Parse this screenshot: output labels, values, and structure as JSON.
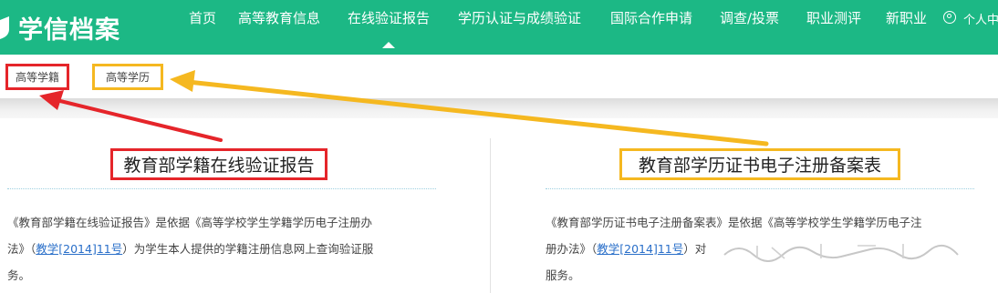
{
  "brand": {
    "name": "学信档案"
  },
  "nav": {
    "items": [
      "首页",
      "高等教育信息",
      "在线验证报告",
      "学历认证与成绩验证",
      "国际合作申请",
      "调查/投票",
      "职业测评",
      "新职业"
    ],
    "active": "在线验证报告",
    "user_label": "个人中"
  },
  "tabs": {
    "left": "高等学籍",
    "right": "高等学历"
  },
  "panels": {
    "left": {
      "title": "教育部学籍在线验证报告",
      "desc_line1": "《教育部学籍在线验证报告》是依据《高等学校学生学籍学历电子注册办",
      "desc_line2_pre": "法》（",
      "desc_link": "教学[2014]11号",
      "desc_line2_post": "）为学生本人提供的学籍注册信息网上查询验证服",
      "desc_line3": "务。"
    },
    "right": {
      "title": "教育部学历证书电子注册备案表",
      "desc_line1": "《教育部学历证书电子注册备案表》是依据《高等学校学生学籍学历电子注",
      "desc_line2_pre": "册办法》（",
      "desc_link": "教学[2014]11号",
      "desc_line2_post": "）对",
      "desc_line3": "服务。"
    }
  },
  "colors": {
    "header_bg": "#1cb885",
    "red_box": "#e5252a",
    "yellow_box": "#f5b820",
    "link": "#2a6fc9"
  }
}
